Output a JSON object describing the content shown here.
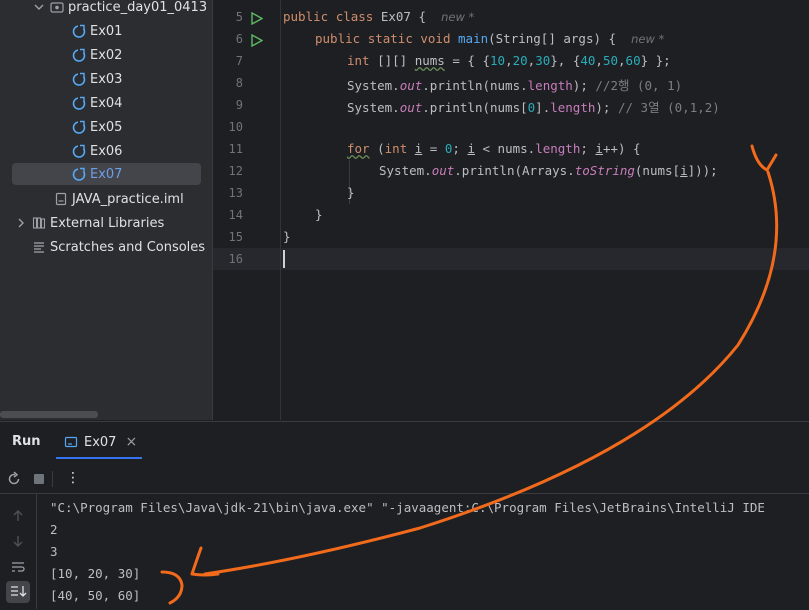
{
  "project_tree": {
    "folder": "practice_day01_0413",
    "files": [
      "Ex01",
      "Ex02",
      "Ex03",
      "Ex04",
      "Ex05",
      "Ex06",
      "Ex07"
    ],
    "selected": "Ex07",
    "iml": "JAVA_practice.iml",
    "external_libraries": "External Libraries",
    "scratches": "Scratches and Consoles"
  },
  "editor": {
    "line_numbers": [
      "5",
      "6",
      "7",
      "8",
      "9",
      "10",
      "11",
      "12",
      "13",
      "14",
      "15",
      "16"
    ],
    "hints": {
      "new": "new *"
    },
    "tokens": {
      "public": "public",
      "class": "class",
      "class_name": "Ex07",
      "brace_open": " {",
      "static": "static",
      "void": "void",
      "main": "main",
      "main_args": "(String[] args) {",
      "int": "int",
      "arr_decl": " [][] ",
      "nums": "nums",
      "init_a": " = { {",
      "n10": "10",
      "n20": "20",
      "n30": "30",
      "n40": "40",
      "n50": "50",
      "n60": "60",
      "comma": ",",
      "init_b": "}, {",
      "init_c": "} };",
      "system": "System.",
      "out": "out",
      "println_open": ".println(",
      "nums_length": "nums.",
      "length": "length",
      "close_semi": ");",
      "comment1": "//2행 (0, 1)",
      "nums0": "nums[",
      "zero": "0",
      "bracket_dot": "].",
      "comment2": "// 3열 (0,1,2)",
      "for": "for",
      "for_open": " (",
      "i": "i",
      "assign": " = ",
      "semi": "; ",
      "lt": " < nums.",
      "semi2": "; ",
      "inc": "++) {",
      "arrays": "Arrays.",
      "toString": "toString",
      "ts_open": "(nums[",
      "ts_close": "]));",
      "brace_close": "}"
    }
  },
  "run_panel": {
    "title": "Run",
    "tab": "Ex07",
    "tab_close": "×",
    "more": "⋮",
    "output": [
      "\"C:\\Program Files\\Java\\jdk-21\\bin\\java.exe\" \"-javaagent:C:\\Program Files\\JetBrains\\IntelliJ IDE",
      "2",
      "3",
      "[10, 20, 30]",
      "[40, 50, 60]"
    ]
  },
  "colors": {
    "accent": "#3574f0",
    "annotation": "#f26a1b"
  }
}
